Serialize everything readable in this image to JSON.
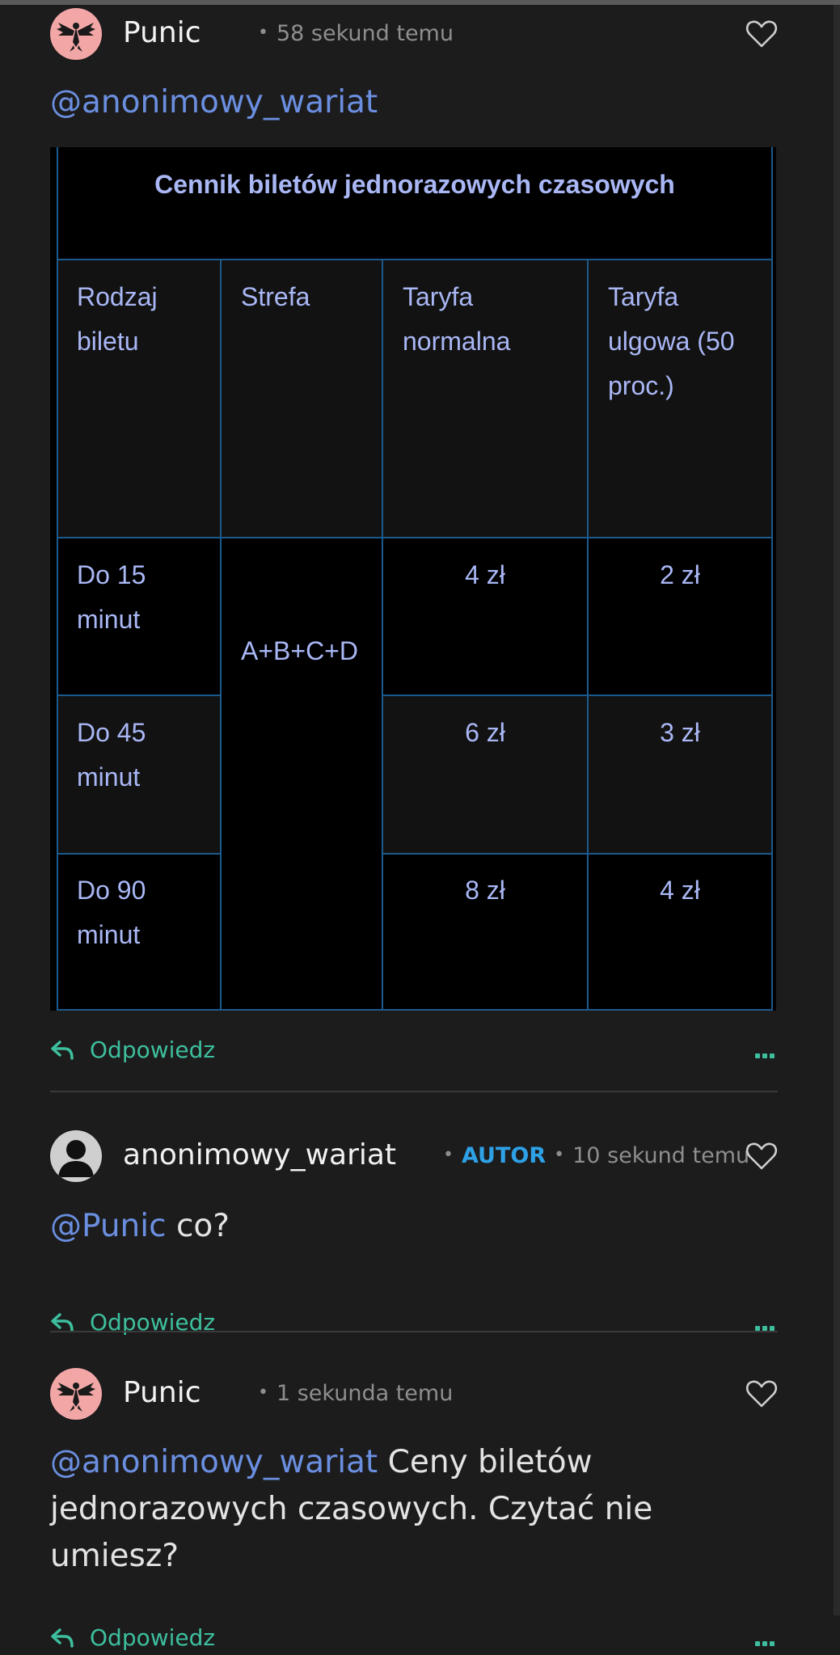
{
  "comments": [
    {
      "username": "Punic",
      "time": "58 sekund temu",
      "mention": "@anonimowy_wariat",
      "text": "",
      "reply_label": "Odpowiedz"
    },
    {
      "username": "anonimowy_wariat",
      "badge": "AUTOR",
      "time": "10 sekund temu",
      "mention": "@Punic",
      "text": " co?",
      "reply_label": "Odpowiedz"
    },
    {
      "username": "Punic",
      "time": "1 sekunda temu",
      "mention": "@anonimowy_wariat",
      "text": " Ceny biletów jednorazowych czasowych. Czytać nie umiesz?",
      "reply_label": "Odpowiedz"
    }
  ],
  "ticket_table": {
    "title": "Cennik biletów jednorazowych czasowych",
    "headers": [
      "Rodzaj biletu",
      "Strefa",
      "Taryfa normalna",
      "Taryfa ulgowa (50 proc.)"
    ],
    "zone": "A+B+C+D",
    "rows": [
      {
        "type": "Do 15 minut",
        "normal": "4 zł",
        "reduced": "2 zł"
      },
      {
        "type": "Do 45 minut",
        "normal": "6 zł",
        "reduced": "3 zł"
      },
      {
        "type": "Do 90 minut",
        "normal": "8 zł",
        "reduced": "4 zł"
      }
    ]
  },
  "colors": {
    "background": "#1c1c1d",
    "mention": "#6b8fe0",
    "reply": "#3dbf9d",
    "author_badge": "#2ea1e6",
    "table_text": "#a9b7f5",
    "table_border": "#1c5a8c"
  },
  "icons": [
    "heart-icon",
    "reply-icon",
    "more-icon",
    "eagle-avatar-icon",
    "user-silhouette-icon"
  ]
}
